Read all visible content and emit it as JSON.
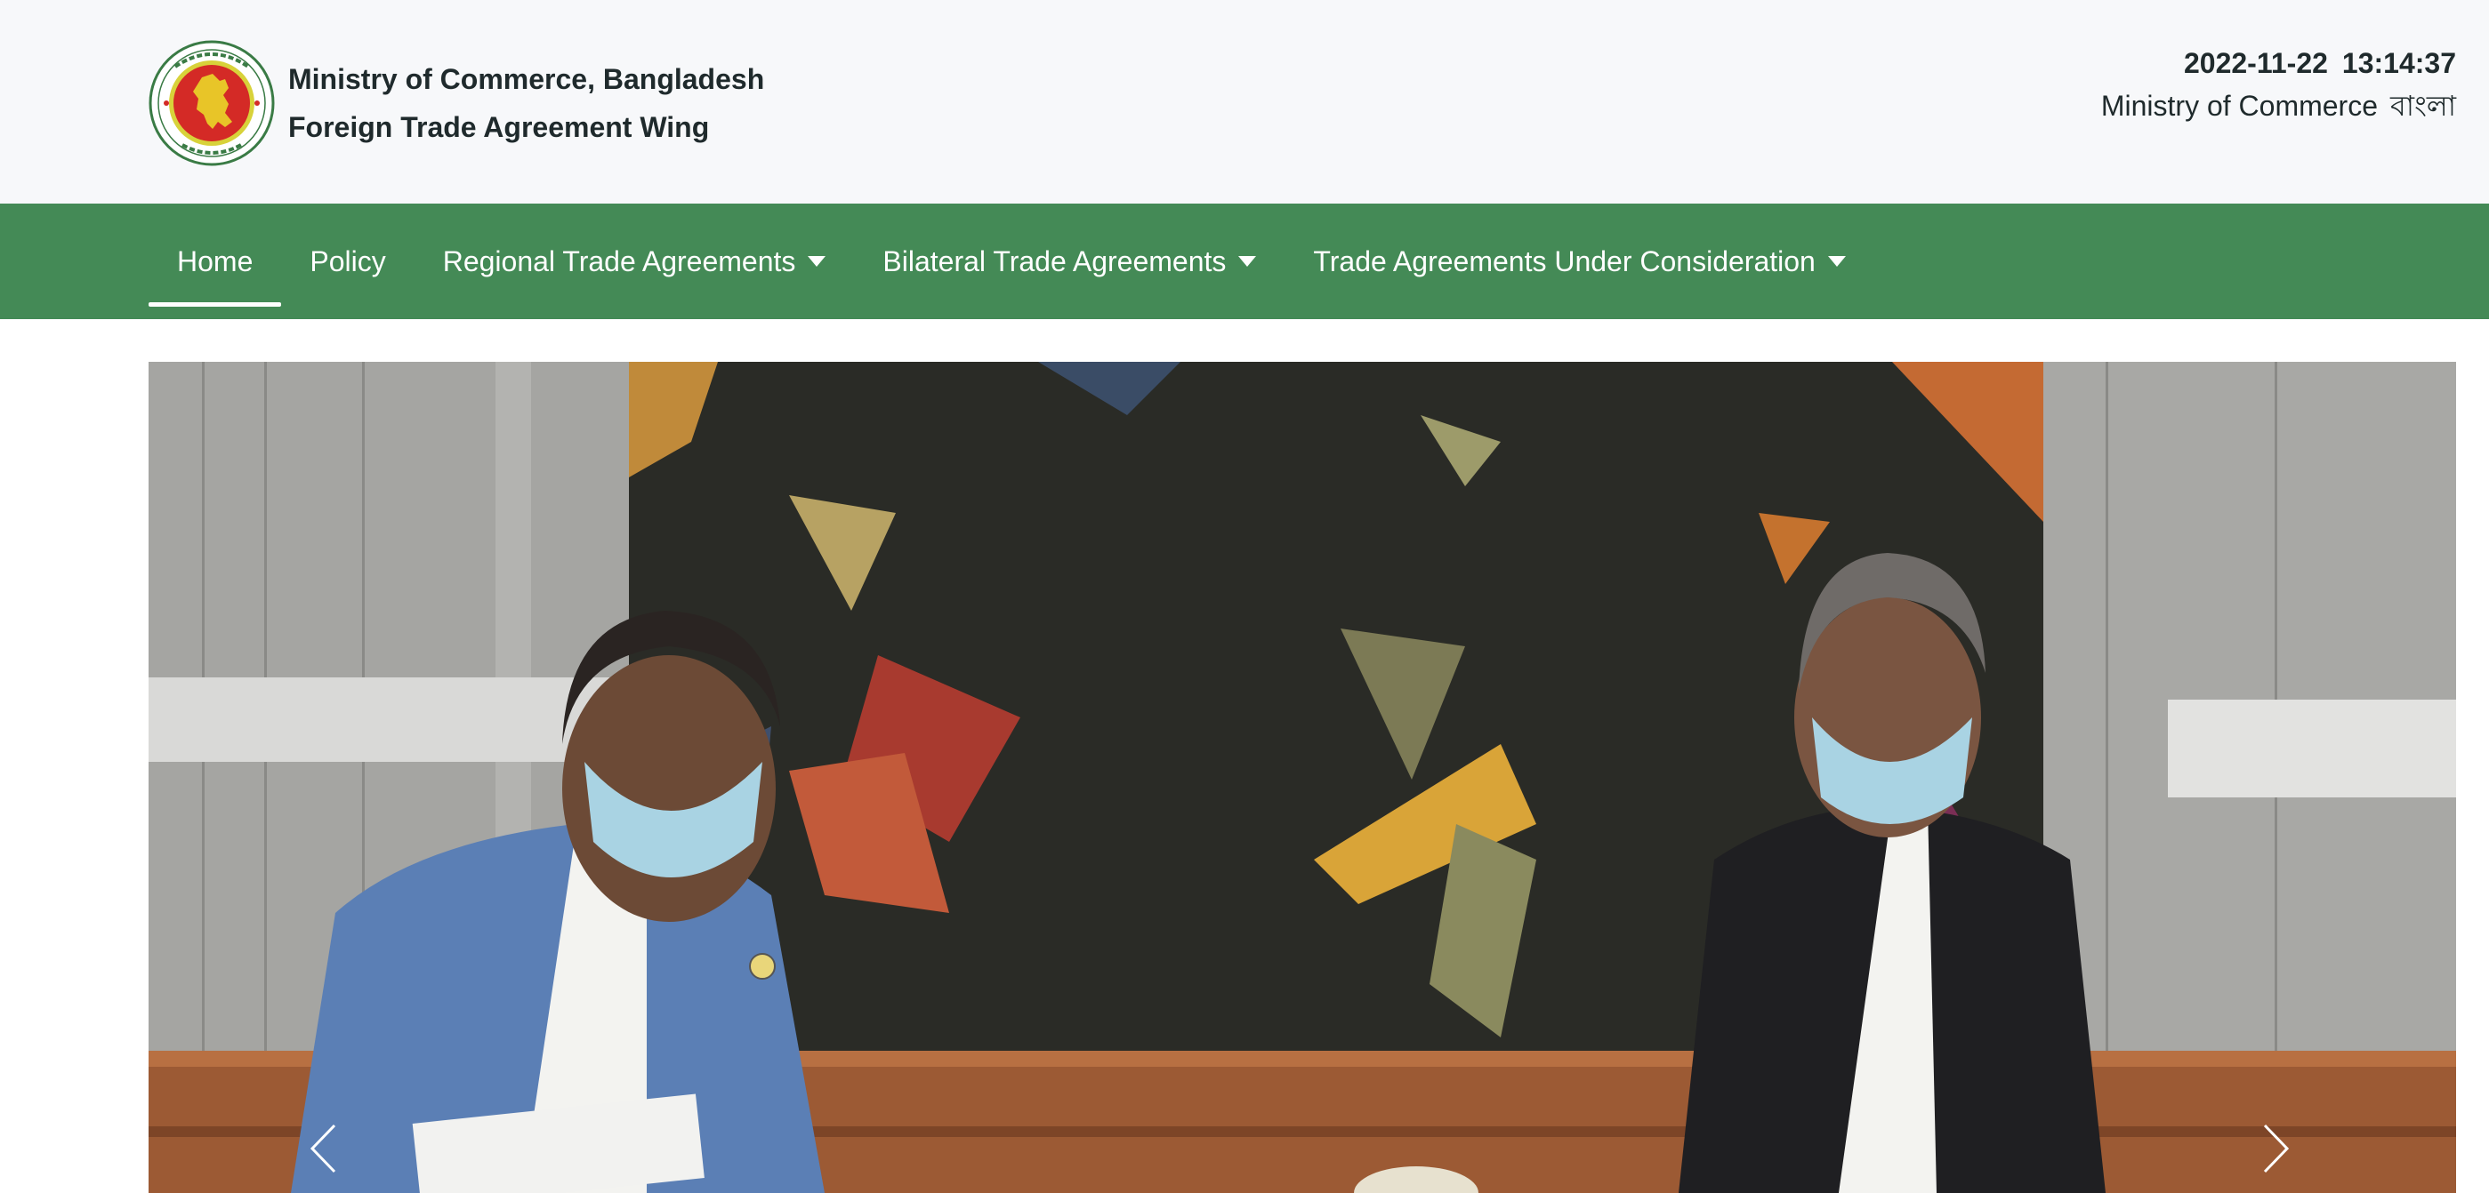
{
  "header": {
    "ministry_name": "Ministry of Commerce, Bangladesh",
    "wing_name": "Foreign Trade Agreement Wing",
    "date": "2022-11-22",
    "time": "13:14:37",
    "ministry_link": "Ministry of Commerce",
    "language_link": "বাংলা",
    "emblem_icon": "government-of-bangladesh-emblem"
  },
  "nav": {
    "items": [
      {
        "label": "Home",
        "active": true,
        "has_dropdown": false
      },
      {
        "label": "Policy",
        "active": false,
        "has_dropdown": false
      },
      {
        "label": "Regional Trade Agreements",
        "active": false,
        "has_dropdown": true
      },
      {
        "label": "Bilateral Trade Agreements",
        "active": false,
        "has_dropdown": true
      },
      {
        "label": "Trade Agreements Under Consideration",
        "active": false,
        "has_dropdown": true
      }
    ]
  },
  "hero": {
    "prev_icon": "chevron-left-icon",
    "next_icon": "chevron-right-icon"
  },
  "colors": {
    "header_bg": "#f7f8fa",
    "nav_bg": "#448a56",
    "nav_text": "#ffffff",
    "text_dark": "#1f2a2c",
    "emblem_red": "#d42a26",
    "emblem_green": "#3a7b45"
  }
}
